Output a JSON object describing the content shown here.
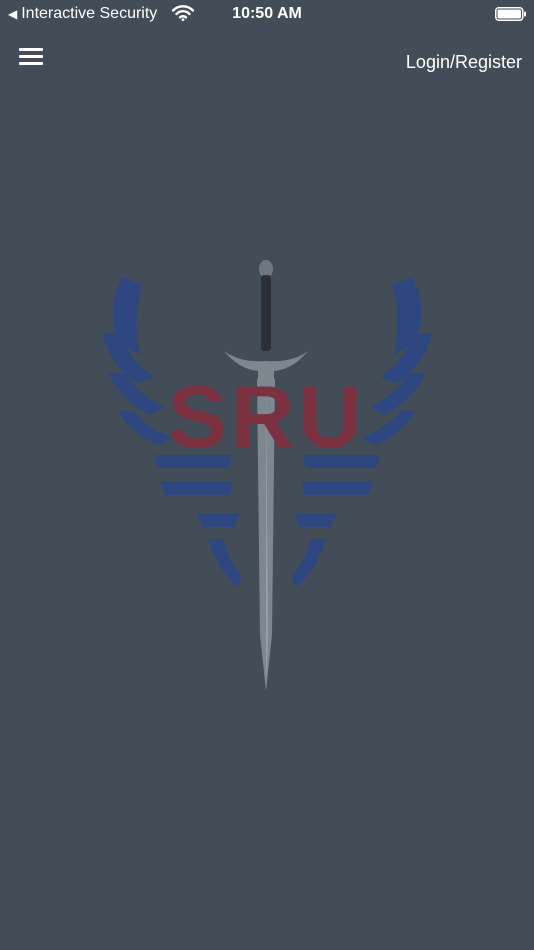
{
  "status_bar": {
    "back_app_label": "Interactive Security",
    "time": "10:50 AM"
  },
  "header": {
    "login_label": "Login/Register"
  },
  "logo": {
    "text": "SRU"
  },
  "colors": {
    "background": "#434d57",
    "wing_blue": "#2e4784",
    "logo_red": "#7c3140",
    "blade_gray": "#7d8790"
  }
}
